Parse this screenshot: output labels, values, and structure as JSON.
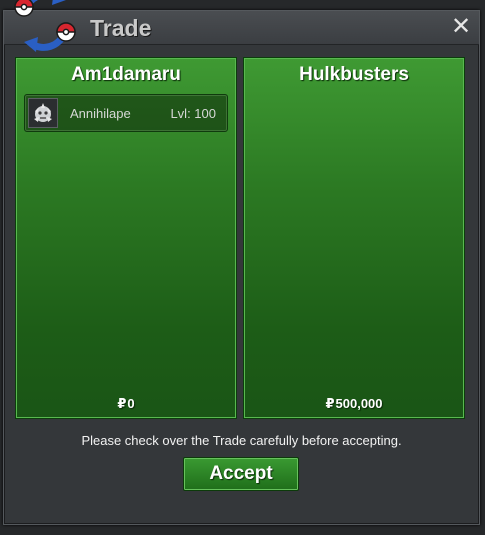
{
  "window": {
    "title": "Trade",
    "close_symbol": "✕",
    "logo_icon": "trade-swap-pokeball-icon",
    "close_icon": "close-icon"
  },
  "left_panel": {
    "player_name": "Am1damaru",
    "items": [
      {
        "icon": "annihilape-sprite-icon",
        "name": "Annihilape",
        "level": "Lvl: 100"
      }
    ],
    "money_symbol": "₽",
    "money": "0"
  },
  "right_panel": {
    "player_name": "Hulkbusters",
    "items": [],
    "money_symbol": "₽",
    "money": "500,000"
  },
  "notice": "Please check over the Trade carefully before accepting.",
  "accept_label": "Accept",
  "colors": {
    "panel_green": "#2c7a23",
    "panel_border": "#58b84f",
    "window_bg": "#34373a",
    "button_green": "#2f8a28",
    "logo_blue": "#2a5fc4",
    "logo_red": "#d8262f"
  }
}
